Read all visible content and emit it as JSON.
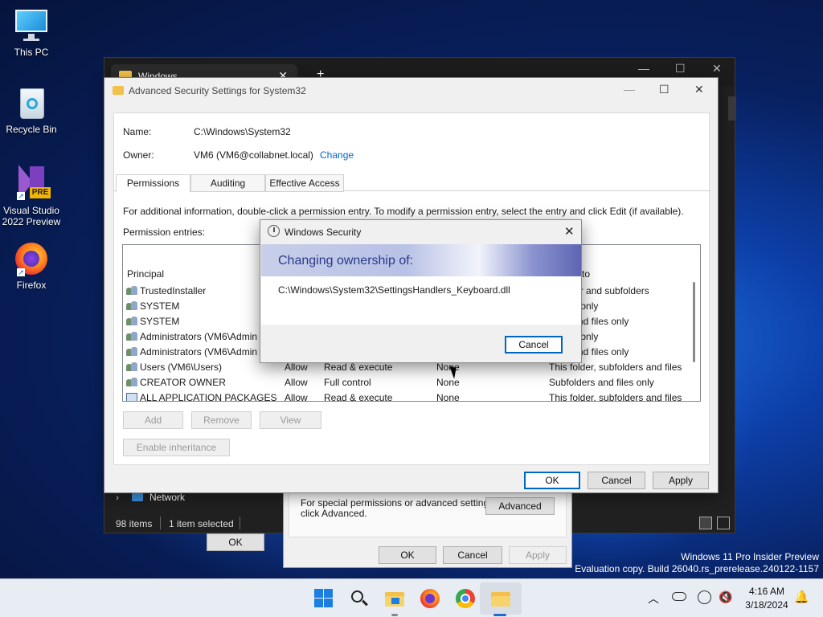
{
  "desktop": {
    "icons": [
      {
        "label": "This PC",
        "icon": "monitor-icon"
      },
      {
        "label": "Recycle Bin",
        "icon": "recycle-bin-icon"
      },
      {
        "label": "Visual Studio 2022 Preview",
        "line1": "Visual Studio",
        "line2": "2022 Preview",
        "badge": "PRE",
        "icon": "visual-studio-icon"
      },
      {
        "label": "Firefox",
        "icon": "firefox-icon"
      }
    ],
    "watermark": {
      "line1": "Windows 11 Pro Insider Preview",
      "line2": "Evaluation copy. Build 26040.rs_prerelease.240122-1157"
    }
  },
  "explorer": {
    "tab_title": "Windows",
    "nav_item": "Network",
    "status_count": "98 items",
    "status_selected": "1 item selected",
    "ok_label": "OK"
  },
  "properties": {
    "hint": "For special permissions or advanced settings, click Advanced.",
    "hint_line1": "For special permissions or advanced settings,",
    "hint_line2": "click Advanced.",
    "advanced_label": "Advanced",
    "ok_label": "OK",
    "cancel_label": "Cancel",
    "apply_label": "Apply"
  },
  "advanced_security": {
    "title": "Advanced Security Settings for System32",
    "name_label": "Name:",
    "name_value": "C:\\Windows\\System32",
    "owner_label": "Owner:",
    "owner_value": "VM6 (VM6@collabnet.local)",
    "change_link": "Change",
    "tabs": [
      "Permissions",
      "Auditing",
      "Effective Access"
    ],
    "info_text": "For additional information, double-click a permission entry. To modify a permission entry, select the entry and click Edit (if available).",
    "entries_label": "Permission entries:",
    "col_principal": "Principal",
    "col_applies_partial": "to",
    "entries": [
      {
        "principal": "TrustedInstaller",
        "type": "",
        "access": "",
        "inherited": "",
        "applies": "older and subfolders"
      },
      {
        "principal": "SYSTEM",
        "type": "",
        "access": "",
        "inherited": "",
        "applies": "lder only"
      },
      {
        "principal": "SYSTEM",
        "type": "",
        "access": "",
        "inherited": "",
        "applies": "rs and files only"
      },
      {
        "principal": "Administrators (VM6\\Admin",
        "type": "",
        "access": "",
        "inherited": "",
        "applies": "lder only"
      },
      {
        "principal": "Administrators (VM6\\Admin",
        "type": "",
        "access": "",
        "inherited": "",
        "applies": "rs and files only"
      },
      {
        "principal": "Users (VM6\\Users)",
        "type": "Allow",
        "access": "Read & execute",
        "inherited": "None",
        "applies": "This folder, subfolders and files"
      },
      {
        "principal": "CREATOR OWNER",
        "type": "Allow",
        "access": "Full control",
        "inherited": "None",
        "applies": "Subfolders and files only"
      },
      {
        "principal": "ALL APPLICATION PACKAGES",
        "type": "Allow",
        "access": "Read & execute",
        "inherited": "None",
        "applies": "This folder, subfolders and files"
      }
    ],
    "add_label": "Add",
    "remove_label": "Remove",
    "view_label": "View",
    "enable_inheritance_label": "Enable inheritance",
    "ok_label": "OK",
    "cancel_label": "Cancel",
    "apply_label": "Apply"
  },
  "security_popup": {
    "title": "Windows Security",
    "banner": "Changing ownership of:",
    "path": "C:\\Windows\\System32\\SettingsHandlers_Keyboard.dll",
    "cancel_label": "Cancel"
  },
  "taskbar": {
    "apps": [
      "start-icon",
      "search-icon",
      "file-explorer-icon",
      "firefox-icon",
      "chrome-icon",
      "file-explorer-active-icon"
    ],
    "time": "4:16 AM",
    "date": "3/18/2024"
  }
}
